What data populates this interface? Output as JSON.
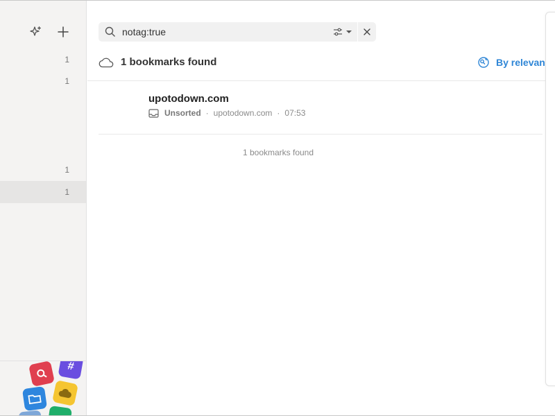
{
  "sidebar": {
    "counts": [
      "1",
      "1",
      "1",
      "1"
    ],
    "selected_index": 3
  },
  "search": {
    "value": "notag:true"
  },
  "results": {
    "title": "1 bookmarks found",
    "sort_label": "By relevance",
    "footer": "1 bookmarks found"
  },
  "bookmarks": [
    {
      "title": "upotodown.com",
      "collection": "Unsorted",
      "domain": "upotodown.com",
      "time": "07:53"
    }
  ],
  "colors": {
    "accent": "#2f86d6",
    "sidebar_bg": "#f4f3f2",
    "selected_row": "#e6e5e4"
  }
}
